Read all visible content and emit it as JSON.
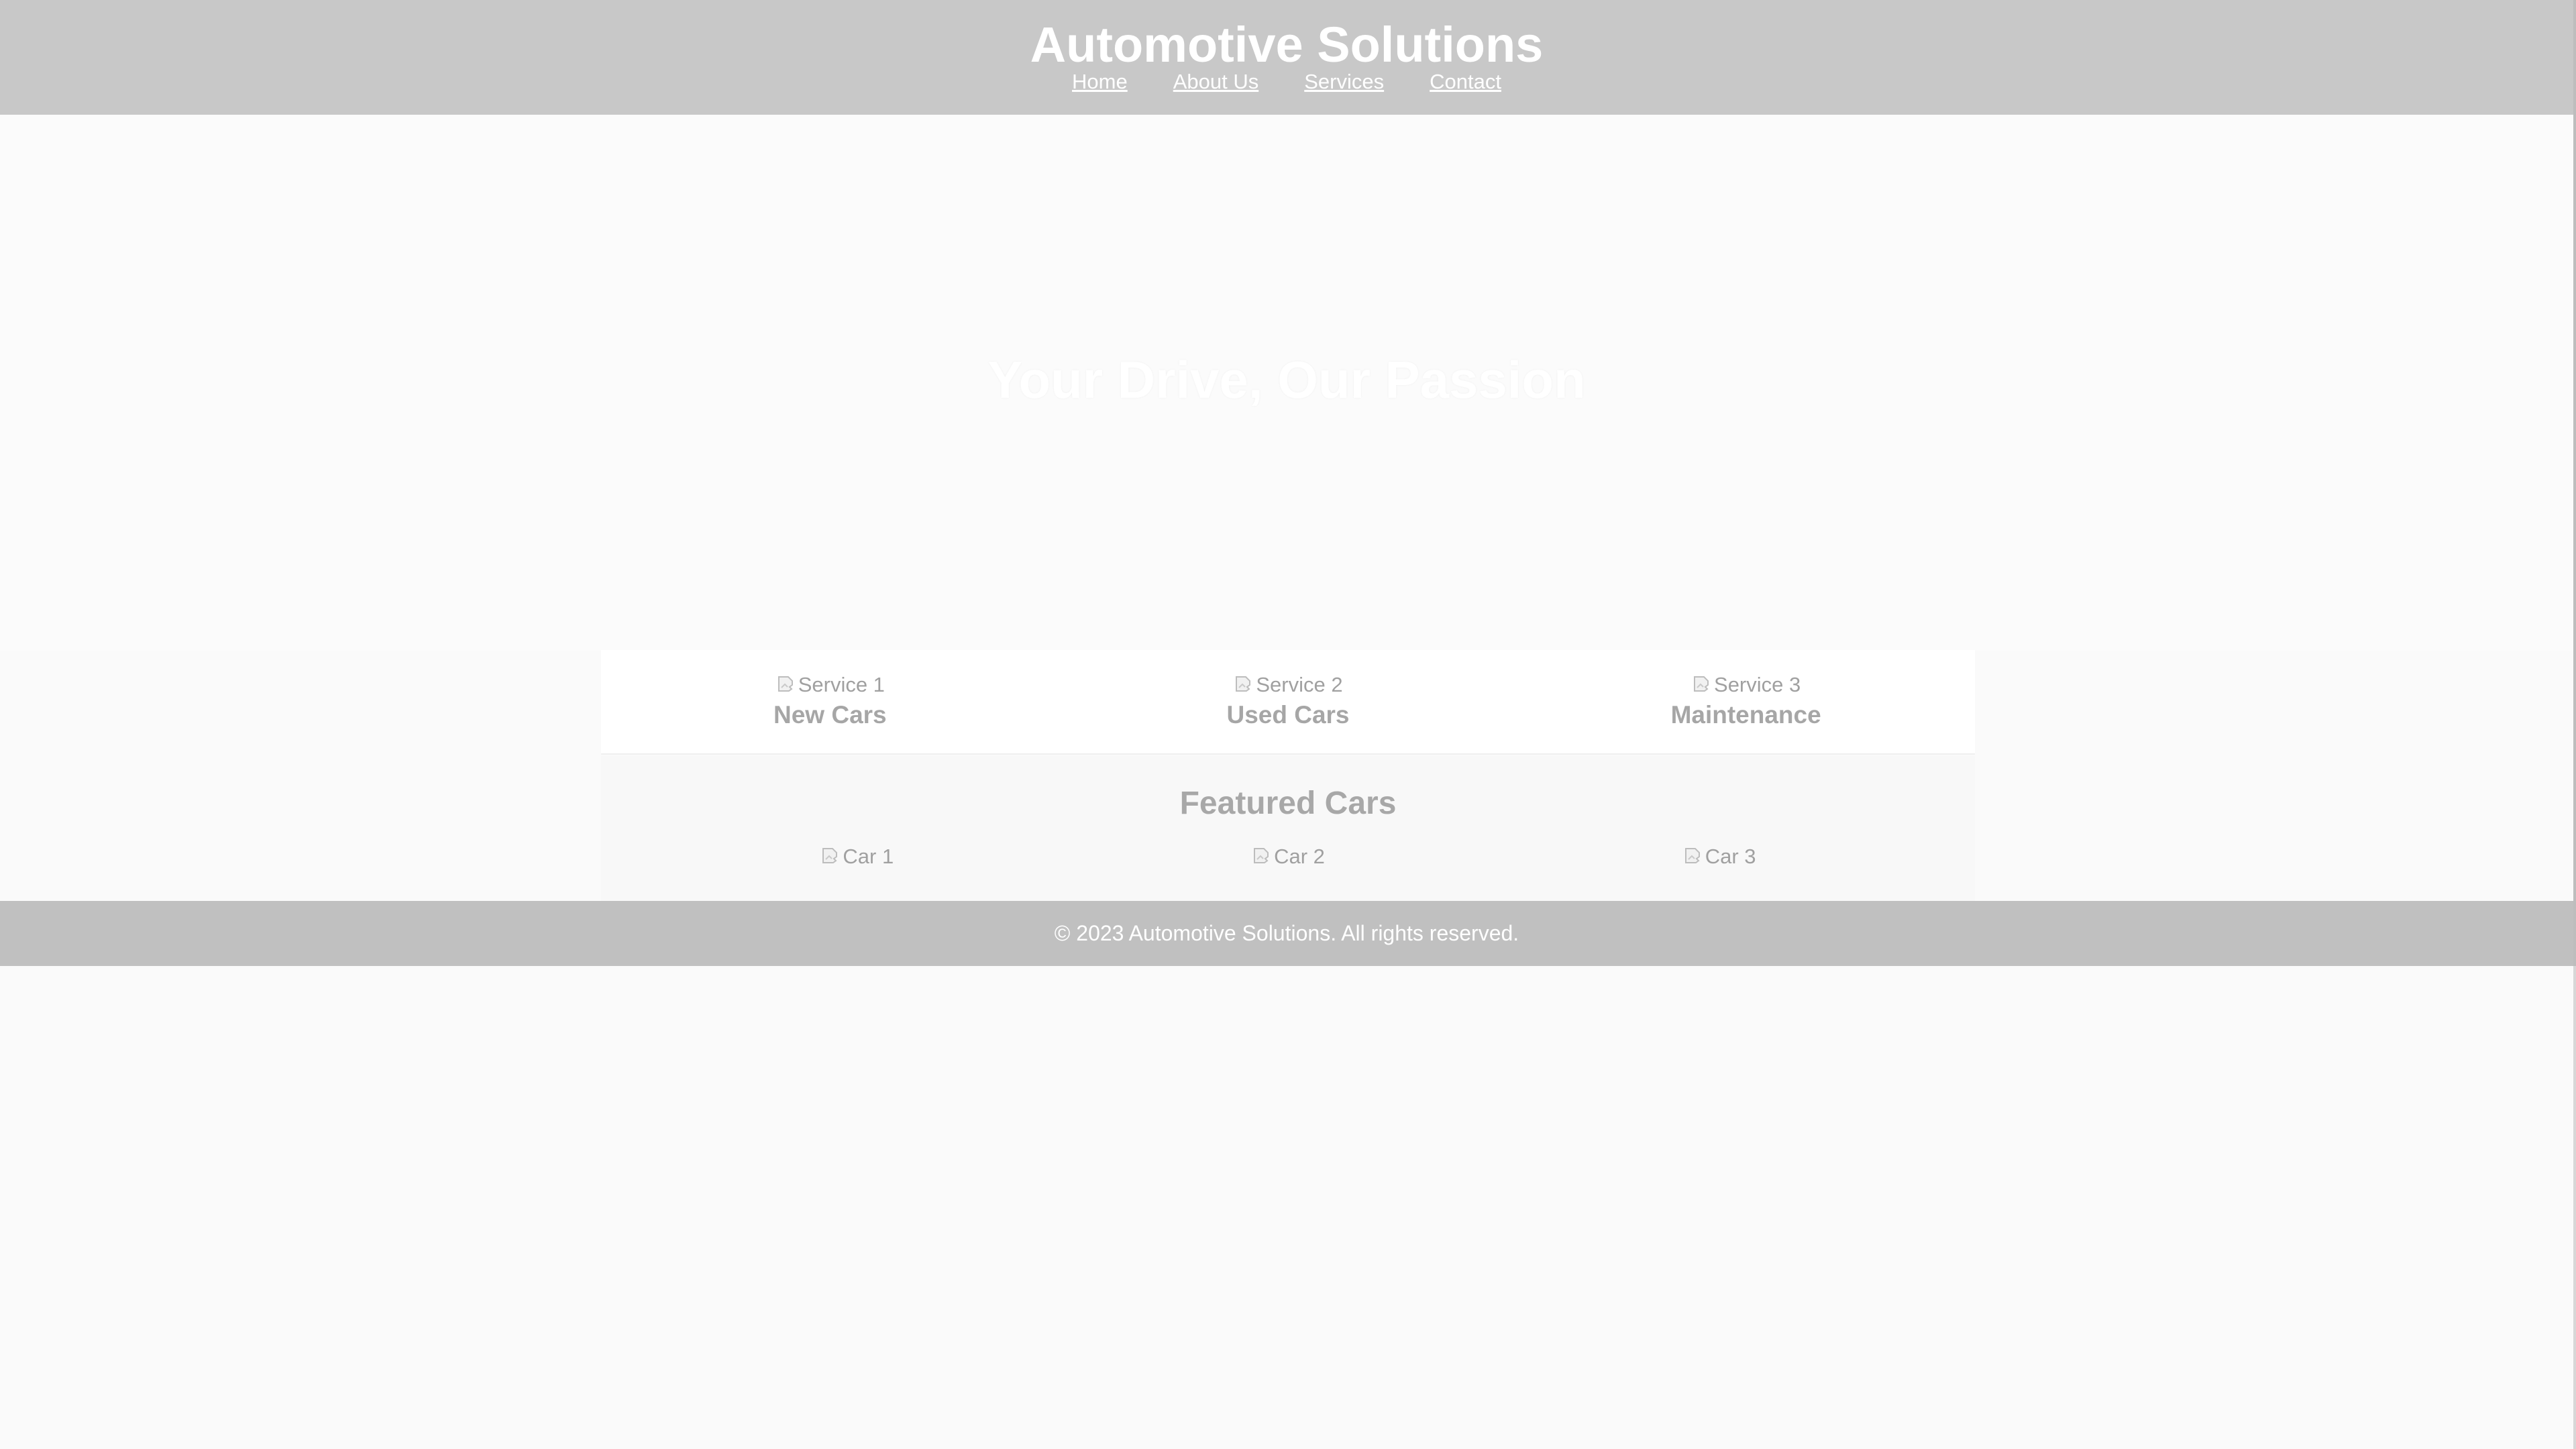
{
  "header": {
    "title": "Automotive Solutions",
    "nav": [
      {
        "label": "Home"
      },
      {
        "label": "About Us"
      },
      {
        "label": "Services"
      },
      {
        "label": "Contact"
      }
    ]
  },
  "hero": {
    "title": "Your Drive, Our Passion"
  },
  "services": [
    {
      "image_alt": "Service 1",
      "name": "New Cars"
    },
    {
      "image_alt": "Service 2",
      "name": "Used Cars"
    },
    {
      "image_alt": "Service 3",
      "name": "Maintenance"
    }
  ],
  "featured": {
    "title": "Featured Cars",
    "cars": [
      {
        "image_alt": "Car 1"
      },
      {
        "image_alt": "Car 2"
      },
      {
        "image_alt": "Car 3"
      }
    ]
  },
  "footer": {
    "text": "© 2023 Automotive Solutions. All rights reserved."
  },
  "icons": {
    "broken_image": "broken-image-icon"
  },
  "colors": {
    "header_bg": "#c8c8c8",
    "footer_bg": "#c0c0c0",
    "page_bg": "#fafafa",
    "text_white": "#ffffff",
    "muted_text": "#a6a6a6"
  }
}
